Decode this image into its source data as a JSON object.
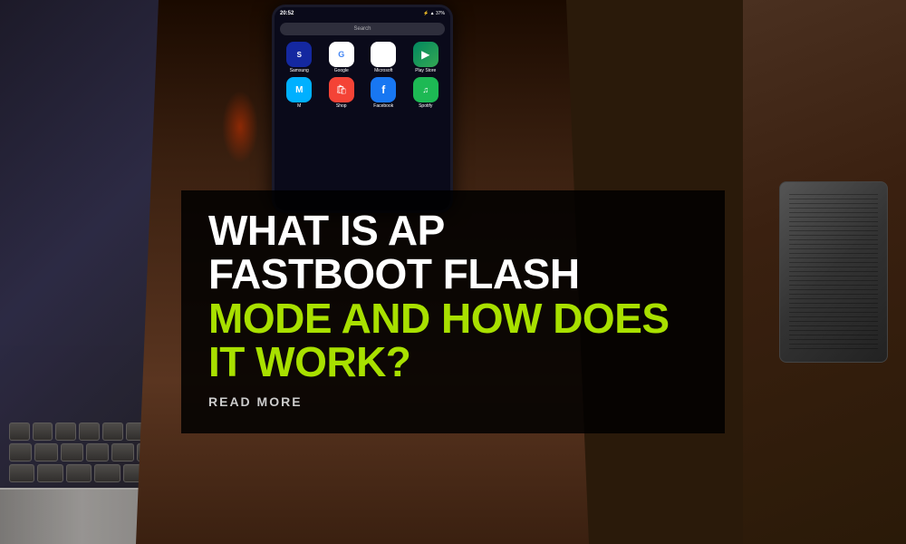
{
  "background": {
    "color": "#2a1a0a"
  },
  "phone": {
    "statusBar": {
      "time": "20:52",
      "icons": "⚡ ▲ 37%"
    },
    "searchPlaceholder": "Search",
    "apps": [
      {
        "name": "Samsung",
        "iconClass": "icon-samsung",
        "emoji": "⊞"
      },
      {
        "name": "Google",
        "iconClass": "icon-google",
        "emoji": "G"
      },
      {
        "name": "Microsoft",
        "iconClass": "icon-microsoft",
        "emoji": "⊟"
      },
      {
        "name": "Play Store",
        "iconClass": "icon-playstore",
        "emoji": "▶"
      },
      {
        "name": "M",
        "iconClass": "icon-m",
        "emoji": "M"
      },
      {
        "name": "Shop",
        "iconClass": "icon-shopbag",
        "emoji": "🛍"
      },
      {
        "name": "Facebook",
        "iconClass": "icon-facebook",
        "emoji": "f"
      },
      {
        "name": "Spotify",
        "iconClass": "icon-spotify",
        "emoji": "♫"
      }
    ]
  },
  "article": {
    "headlineWhite1": "WHAT IS AP",
    "headlineWhite2": "FASTBOOT FLASH",
    "headlineGreen": "MODE AND HOW DOES",
    "headlineGreen2": "IT WORK?",
    "readMore": "READ MORE"
  }
}
